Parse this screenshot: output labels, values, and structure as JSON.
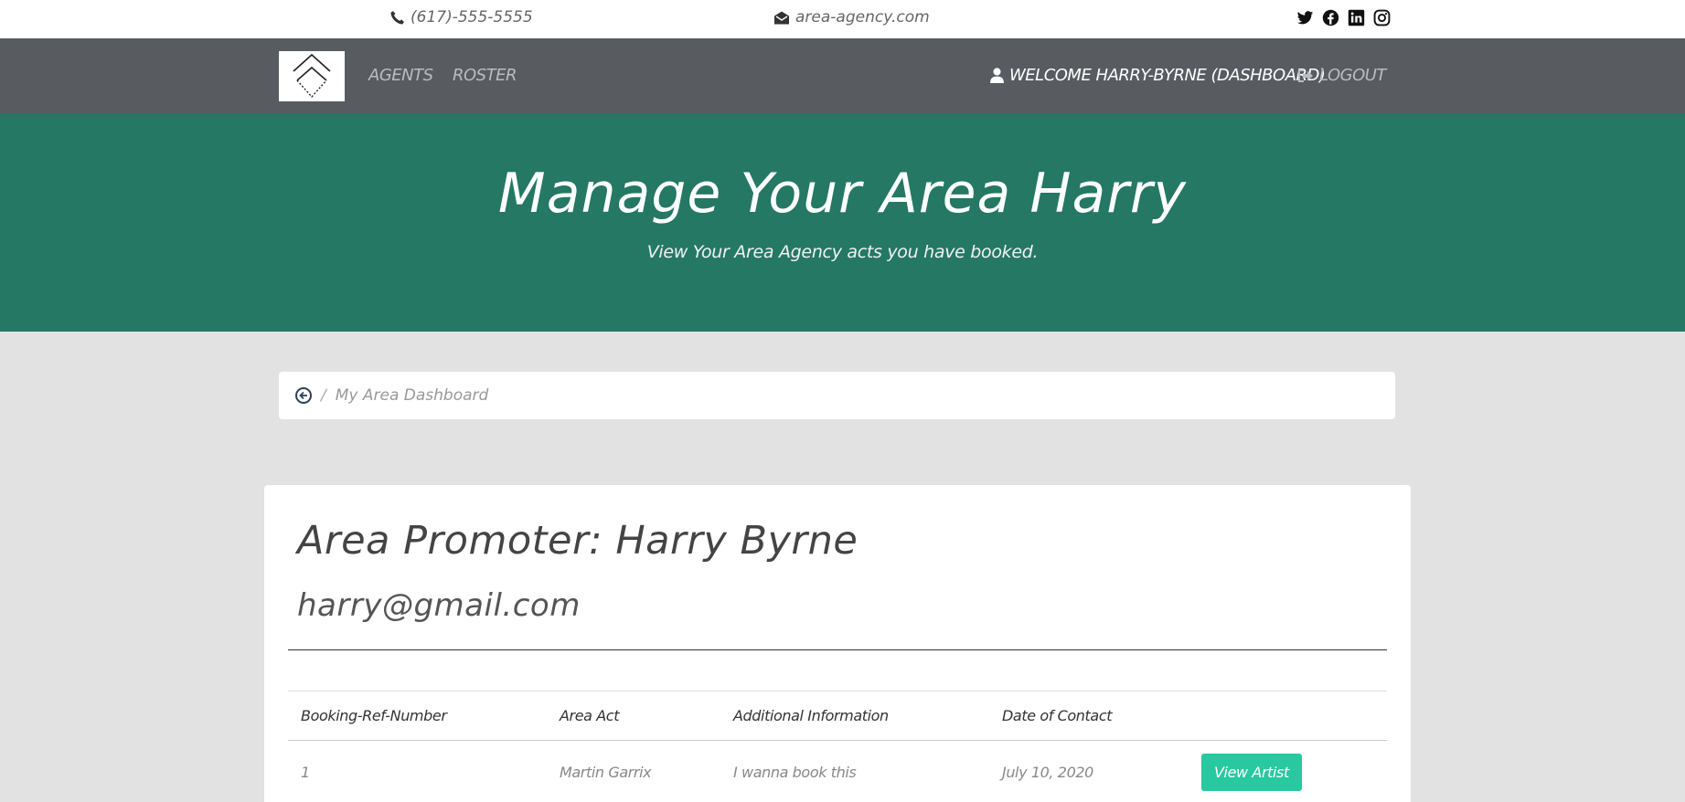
{
  "topbar": {
    "phone": "(617)-555-5555",
    "email": "area-agency.com",
    "social_icons": [
      "twitter-icon",
      "facebook-icon",
      "linkedin-icon",
      "instagram-icon"
    ]
  },
  "nav": {
    "agents": "AGENTS",
    "roster": "ROSTER",
    "welcome": "WELCOME HARRY-BYRNE (DASHBOARD)",
    "logout": "LOGOUT"
  },
  "hero": {
    "title": "Manage Your Area Harry",
    "subtitle": "View Your Area Agency acts you have booked."
  },
  "breadcrumb": {
    "separator": "/",
    "current": "My Area Dashboard"
  },
  "profile": {
    "heading": "Area Promoter: Harry Byrne",
    "email": "harry@gmail.com"
  },
  "table": {
    "headers": [
      "Booking-Ref-Number",
      "Area Act",
      "Additional Information",
      "Date of Contact",
      ""
    ],
    "rows": [
      {
        "ref": "1",
        "act": "Martin Garrix",
        "info": "I wanna book this",
        "date": "July 10, 2020",
        "action": "View Artist"
      }
    ]
  },
  "colors": {
    "hero_bg": "#247864",
    "navbar_bg": "#585c61",
    "page_bg": "#e2e2e2",
    "button_bg": "#28c8a0"
  }
}
